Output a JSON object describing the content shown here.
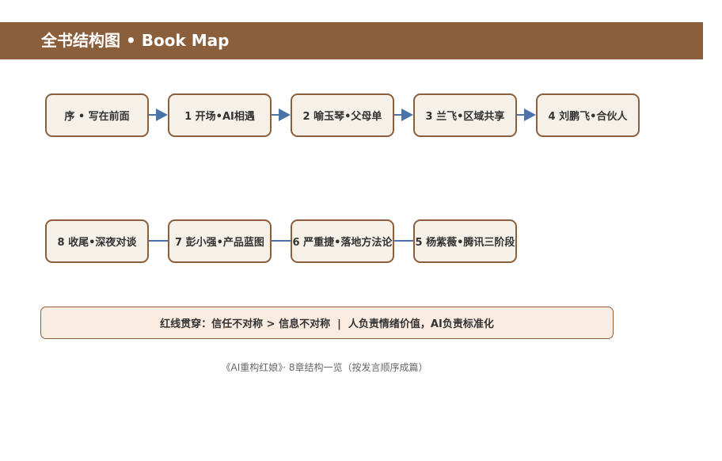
{
  "header": {
    "title": "全书结构图 • Book Map"
  },
  "colors": {
    "header_bg": "#8b5e3c",
    "node_bg": "#f5f1e8",
    "node_border": "#8b5e3c",
    "connector": "#4a74a8",
    "summary_bg": "#fbece2"
  },
  "flow": {
    "row1": [
      {
        "label": "序 • 写在前面"
      },
      {
        "label": "1 开场•AI相遇"
      },
      {
        "label": "2 喻玉琴•父母单"
      },
      {
        "label": "3 兰飞•区域共享"
      },
      {
        "label": "4 刘鹏飞•合伙人"
      }
    ],
    "row2": [
      {
        "label": "8 收尾•深夜对谈"
      },
      {
        "label": "7 彭小强•产品蓝图"
      },
      {
        "label": "6 严重捷•落地方法论"
      },
      {
        "label": "5 杨紫薇•腾讯三阶段"
      }
    ]
  },
  "summary": {
    "text": "红线贯穿：信任不对称 > 信息不对称  |  人负责情绪价值，AI负责标准化"
  },
  "caption": {
    "text": "《AI重构红娘》· 8章结构一览（按发言顺序成篇）"
  }
}
